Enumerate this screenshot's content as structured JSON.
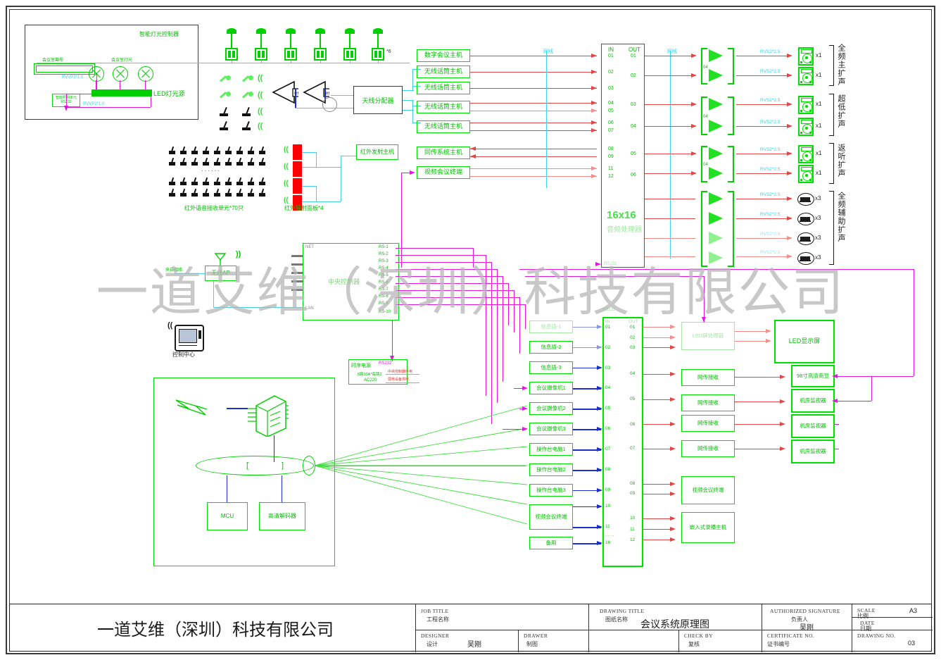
{
  "document": {
    "title": "会议系统原理图",
    "company": "一道艾维（深圳）科技有限公司",
    "watermark": "一道艾维（深圳）科技有限公司"
  },
  "title_block": {
    "job_title_en": "JOB   TITLE",
    "job_title_cn": "工程名称",
    "job_title_value": "",
    "drawing_title_en": "DRAWING   TITLE",
    "drawing_title_cn": "图纸名称",
    "drawing_title_value": "会议系统原理图",
    "authorized_en": "AUTHORIZED   SIGNATURE",
    "authorized_cn": "负责人",
    "authorized_value": "吴刚",
    "scale_en": "SCALE",
    "scale_cn": "比例",
    "scale_value": "A3",
    "date_en": "DATE",
    "date_cn": "日期",
    "date_value": "",
    "designer_en": "DESIGNER",
    "designer_cn": "设计",
    "designer_value": "吴刚",
    "drawer_en": "DRAWER",
    "drawer_cn": "制图",
    "drawer_value": "",
    "check_en": "CHECK   BY",
    "check_cn": "复核",
    "check_value": "",
    "certificate_en": "CERTIFICATE   NO.",
    "certificate_cn": "证书编号",
    "certificate_value": "",
    "drawing_no_en": "DRAWING NO.",
    "drawing_no_value": "03"
  },
  "lighting_inset": {
    "title": "智能灯光控制器",
    "screen_label": "会议室幕布",
    "lamps_label": "会议室灯光",
    "led_label": "LED灯光源",
    "controller_label": "智能照明单元\\nRS232",
    "cable_1": "RVVP2*1.0",
    "cable_2": "RVVP2*1.0",
    "cable_3": "RVVP2*1.0"
  },
  "top_sources": [
    {
      "label": "数字会议主机",
      "in": "01"
    },
    {
      "label": "无线话筒主机",
      "in": "02"
    },
    {
      "label": "无线话筒主机",
      "in": "03"
    },
    {
      "label": "无线话筒主机",
      "in": "04/05"
    },
    {
      "label": "无线话筒主机",
      "in": "06/07"
    },
    {
      "label": "同传系统主机",
      "in": "08/09"
    },
    {
      "label": "视频会议终端",
      "in": "11/12"
    }
  ],
  "antenna_distributor": {
    "label": "天线分配器"
  },
  "ceiling_mic_count": "*6",
  "ir_units": {
    "receiver_label": "红外语音接收单元*70只",
    "panel_label": "红外辐射面板*4",
    "transmitter_label": "红外发射主机"
  },
  "audio_processor": {
    "name": "16x16",
    "subtitle": "音频处理器",
    "in_header": "IN",
    "out_header": "OUT",
    "in_ports": [
      "01",
      "02",
      "03",
      "04",
      "05",
      "06",
      "07",
      "08",
      "09",
      "11",
      "12"
    ],
    "out_ports": [
      "01",
      "02",
      "03",
      "04",
      "05",
      "06"
    ],
    "rs232_label": "RS232"
  },
  "speaker_cable_label": "RVS2*2.5",
  "net_label": "网线",
  "amp_label": "04",
  "speaker_groups": [
    {
      "vlabel": "全频主扩声",
      "qty": [
        "x1",
        "x1"
      ]
    },
    {
      "vlabel": "超低扩声",
      "qty": [
        "x1",
        "x1"
      ]
    },
    {
      "vlabel": "返听扩声",
      "qty": [
        "x1",
        "x1"
      ]
    },
    {
      "vlabel": "全频辅助扩声",
      "qty": [
        "x3",
        "x3",
        "x3",
        "x3"
      ]
    }
  ],
  "central_controller": {
    "label": "中央控制器",
    "net": "NET",
    "lan": "LAN",
    "ports": [
      "RS-1",
      "RS-2",
      "RS-3",
      "RS-4",
      "RS-5",
      "RS-6",
      "RS-7",
      "RS-8",
      "RS-9",
      "RS-10"
    ]
  },
  "wireless_ap": {
    "label": "无线AP"
  },
  "control_center": {
    "label": "控制中心"
  },
  "power_sequencer": {
    "label": "时序电源",
    "spec": "8路30A*每路2",
    "voltage": "AC220",
    "rs232": "RS232",
    "note1": "中央控制器供电",
    "note2": "弱电设备供电"
  },
  "matrix": {
    "in_header": "IN",
    "out_header": "OUT",
    "in_ports": [
      "01",
      "02",
      "03",
      "04",
      "05",
      "06",
      "07",
      "08",
      "09",
      "10",
      "11",
      "16"
    ],
    "out_ports": [
      "01",
      "02",
      "03",
      "04",
      "05",
      "06",
      "07",
      "08",
      "09",
      "10",
      "11",
      "12"
    ],
    "rs232_label": "RS232",
    "ellipsis": "······"
  },
  "matrix_inputs": [
    {
      "label": "信息插-1",
      "port": "01"
    },
    {
      "label": "信息插-2",
      "port": "02"
    },
    {
      "label": "信息插-3",
      "port": "03"
    },
    {
      "label": "会议摄像机1",
      "port": "04"
    },
    {
      "label": "会议摄像机2",
      "port": "05"
    },
    {
      "label": "会议摄像机3",
      "port": "06"
    },
    {
      "label": "操作台电脑1",
      "port": "07"
    },
    {
      "label": "操作台电脑2",
      "port": "08"
    },
    {
      "label": "操作台电脑3",
      "port": "09"
    },
    {
      "label": "视频会议终端",
      "port": "10/11"
    },
    {
      "label": "备用",
      "port": "16"
    }
  ],
  "matrix_outputs": [
    {
      "label": "LED屏处理器"
    },
    {
      "label": "网传接收"
    },
    {
      "label": "网传接收"
    },
    {
      "label": "网传接收"
    },
    {
      "label": "网传接收"
    },
    {
      "label": "视频会议终端"
    },
    {
      "label": "嵌入式录播主机"
    }
  ],
  "displays": [
    {
      "label": "LED显示屏"
    },
    {
      "label": "98寸高清商显"
    },
    {
      "label": "机房监视器"
    },
    {
      "label": "机房监视器"
    },
    {
      "label": "机房监视器"
    }
  ],
  "network_block": {
    "mcu": "MCU",
    "decoder": "高清解码器"
  },
  "colors": {
    "green": "#00e000",
    "red": "#e04848",
    "cyan": "#3fd4ea",
    "magenta": "#e018e0",
    "blue": "#1e2ec8",
    "black": "#1d1d1d"
  }
}
